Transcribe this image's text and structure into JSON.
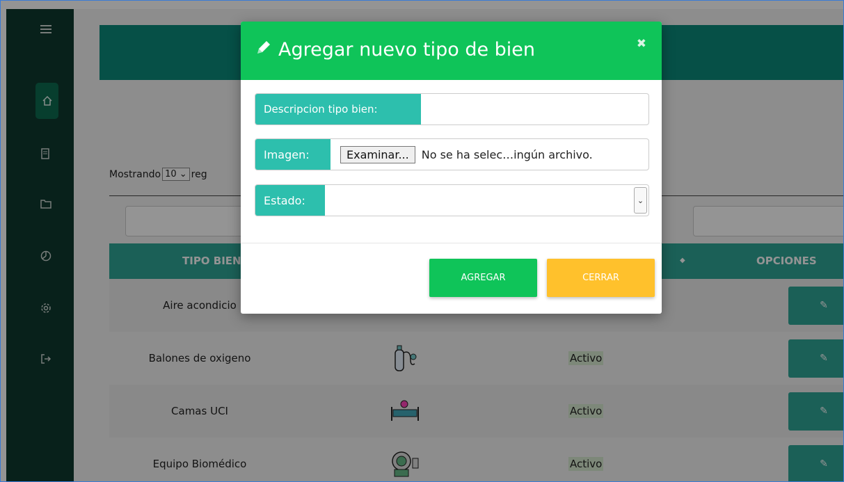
{
  "sidebar": {
    "icons": [
      "menu-icon",
      "home-icon",
      "document-icon",
      "folder-icon",
      "chart-icon",
      "settings-icon",
      "logout-icon"
    ]
  },
  "controls": {
    "showing_label": "Mostrando",
    "showing_value": "10",
    "showing_suffix": "reg"
  },
  "table": {
    "headers": {
      "tipo": "TIPO BIEN",
      "sort_icon": "◆",
      "opciones": "OPCIONES"
    },
    "rows": [
      {
        "tipo": "Aire acondicio",
        "estado": "",
        "image": "air-conditioner-image"
      },
      {
        "tipo": "Balones de oxigeno",
        "estado": "Activo",
        "image": "oxygen-tank-image"
      },
      {
        "tipo": "Camas UCI",
        "estado": "Activo",
        "image": "hospital-bed-image"
      },
      {
        "tipo": "Equipo Biomédico",
        "estado": "Activo",
        "image": "biomedical-equipment-image"
      }
    ]
  },
  "modal": {
    "title": "Agregar nuevo tipo de bien",
    "close_symbol": "✖",
    "descripcion_label": "Descripcion tipo bien:",
    "descripcion_value": "",
    "imagen_label": "Imagen:",
    "file_button": "Examinar...",
    "file_text": "No se ha selec…ingún archivo.",
    "estado_label": "Estado:",
    "estado_value": "",
    "add_button": "AGREGAR",
    "close_button": "CERRAR"
  },
  "colors": {
    "sidebar": "#0f3a2f",
    "teal": "#2fa597",
    "green": "#0fc459",
    "yellow": "#ffc12c"
  }
}
